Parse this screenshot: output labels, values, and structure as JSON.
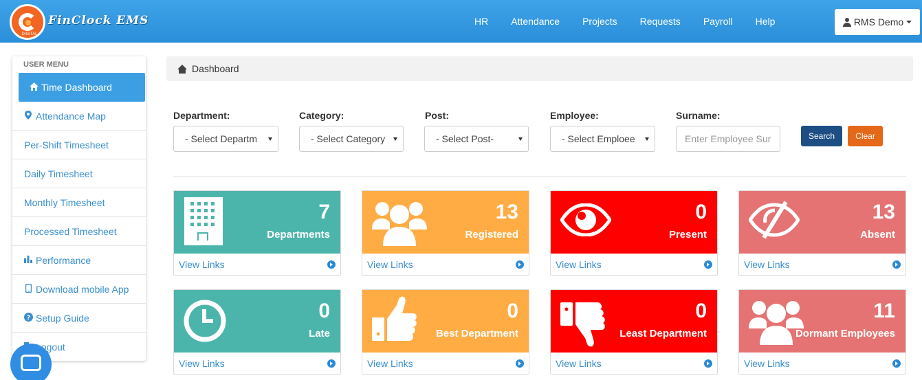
{
  "app": {
    "brand": "FinClock EMS",
    "logo_sub": "DIGITAL"
  },
  "nav": {
    "links": [
      "HR",
      "Attendance",
      "Projects",
      "Requests",
      "Payroll",
      "Help"
    ],
    "user": "RMS Demo"
  },
  "sidebar": {
    "title": "USER MENU",
    "items": [
      {
        "label": "Time Dashboard",
        "icon": "home-icon",
        "active": true
      },
      {
        "label": "Attendance Map",
        "icon": "map-marker-icon"
      },
      {
        "label": "Per-Shift Timesheet"
      },
      {
        "label": "Daily Timesheet"
      },
      {
        "label": "Monthly Timesheet"
      },
      {
        "label": "Processed Timesheet"
      },
      {
        "label": "Performance",
        "icon": "bar-chart-icon"
      },
      {
        "label": "Download mobile App",
        "icon": "mobile-icon"
      },
      {
        "label": "Setup Guide",
        "icon": "question-circle-icon"
      },
      {
        "label": "Logout",
        "icon": "logout-icon"
      }
    ]
  },
  "breadcrumb": {
    "label": "Dashboard"
  },
  "filters": {
    "department": {
      "label": "Department:",
      "value": "- Select Departm"
    },
    "category": {
      "label": "Category:",
      "value": "- Select Category"
    },
    "post": {
      "label": "Post:",
      "value": "- Select Post-"
    },
    "employee": {
      "label": "Employee:",
      "value": "- Select Emploee"
    },
    "surname": {
      "label": "Surname:",
      "placeholder": "Enter Employee Sur"
    },
    "search_label": "Search",
    "clear_label": "Clear"
  },
  "cards": [
    {
      "value": "7",
      "label": "Departments",
      "link": "View Links",
      "color": "#4cb5ab",
      "icon": "building-icon"
    },
    {
      "value": "13",
      "label": "Registered",
      "link": "View Links",
      "color": "#ffac45",
      "icon": "users-icon"
    },
    {
      "value": "0",
      "label": "Present",
      "link": "View Links",
      "color": "#ff0000",
      "icon": "eye-icon"
    },
    {
      "value": "13",
      "label": "Absent",
      "link": "View Links",
      "color": "#e57373",
      "icon": "eye-slash-icon"
    },
    {
      "value": "0",
      "label": "Late",
      "link": "View Links",
      "color": "#4cb5ab",
      "icon": "clock-icon"
    },
    {
      "value": "0",
      "label": "Best Department",
      "link": "View Links",
      "color": "#ffac45",
      "icon": "thumbs-up-icon"
    },
    {
      "value": "0",
      "label": "Least Department",
      "link": "View Links",
      "color": "#ff0000",
      "icon": "thumbs-down-icon"
    },
    {
      "value": "11",
      "label": "Dormant Employees",
      "link": "View Links",
      "color": "#e57373",
      "icon": "users-icon"
    }
  ]
}
